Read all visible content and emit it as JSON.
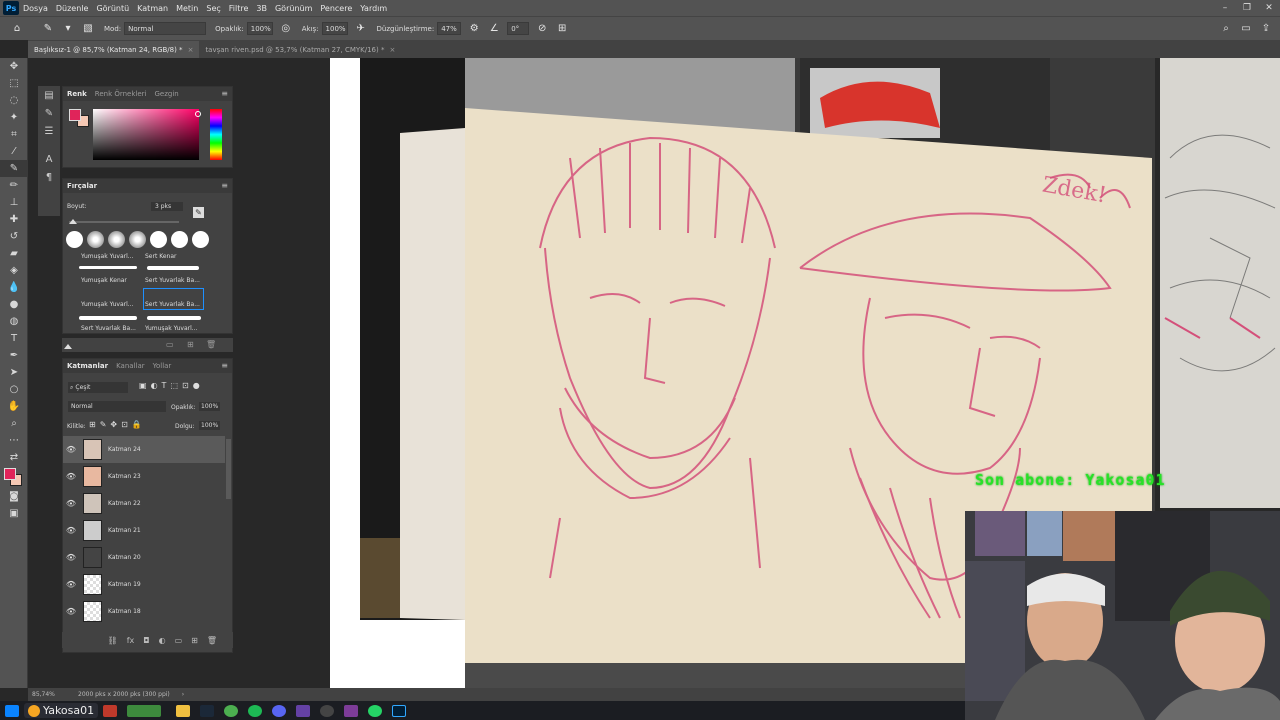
{
  "menu": {
    "app_icon": "Ps",
    "items": [
      "Dosya",
      "Düzenle",
      "Görüntü",
      "Katman",
      "Metin",
      "Seç",
      "Filtre",
      "3B",
      "Görünüm",
      "Pencere",
      "Yardım"
    ]
  },
  "options": {
    "mode_label": "Mod:",
    "mode_value": "Normal",
    "opacity_label": "Opaklık:",
    "opacity_value": "100%",
    "flow_label": "Akış:",
    "flow_value": "100%",
    "smoothing_label": "Düzgünleştirme:",
    "smoothing_value": "47%",
    "angle_value": "0°"
  },
  "tabs": [
    {
      "label": "Başlıksız-1 @ 85,7% (Katman 24, RGB/8) *"
    },
    {
      "label": "tavşan riven.psd @ 53,7% (Katman 27, CMYK/16) *"
    }
  ],
  "color_panel": {
    "tabs": [
      "Renk",
      "Renk Örnekleri",
      "Gezgin"
    ],
    "fg_color": "#e0245a",
    "bg_color": "#f5c8b4"
  },
  "brush_panel": {
    "title": "Fırçalar",
    "size_label": "Boyut:",
    "size_value": "3 pks",
    "labels": [
      "Yumuşak Yuvarl...",
      "Sert Kenar",
      "Yumuşak Kenar",
      "Sert Yuvarlak Ba...",
      "Yumuşak Yuvarl...",
      "Sert Yuvarlak Ba...",
      "Sert Yuvarlak Ba...",
      "Yumuşak Yuvarl..."
    ]
  },
  "layers_panel": {
    "tabs": [
      "Katmanlar",
      "Kanallar",
      "Yollar"
    ],
    "filter_value": "Çeşit",
    "blend_value": "Normal",
    "opacity_label": "Opaklık:",
    "opacity_value": "100%",
    "lock_label": "Kilitle:",
    "fill_label": "Dolgu:",
    "fill_value": "100%",
    "layers": [
      {
        "name": "Katman 24",
        "selected": true
      },
      {
        "name": "Katman 23"
      },
      {
        "name": "Katman 22"
      },
      {
        "name": "Katman 21"
      },
      {
        "name": "Katman 20"
      },
      {
        "name": "Katman 19"
      },
      {
        "name": "Katman 18"
      }
    ]
  },
  "status": {
    "zoom": "85,74%",
    "doc_info": "2000 pks x 2000 pks (300 ppi)"
  },
  "taskbar": {
    "user_label": "Yakosa01"
  },
  "canvas": {
    "sketch_signature": "Zdek!"
  },
  "overlay": {
    "text": "Son abone: Yakosa01"
  }
}
